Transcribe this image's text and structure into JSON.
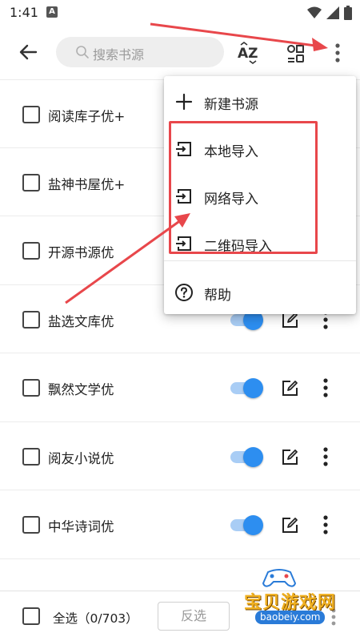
{
  "status_bar": {
    "time": "1:41",
    "notification_letter": "A"
  },
  "toolbar": {
    "search_placeholder": "搜索书源",
    "az_icon": "sort-az-icon",
    "group_icon": "group-icon",
    "more_icon": "more-vertical-icon"
  },
  "sources": [
    {
      "name": "阅读库子优+",
      "enabled": true
    },
    {
      "name": "盐神书屋优+",
      "enabled": true
    },
    {
      "name": "开源书源优",
      "enabled": true
    },
    {
      "name": "盐选文库优",
      "enabled": true
    },
    {
      "name": "飘然文学优",
      "enabled": true
    },
    {
      "name": "阅友小说优",
      "enabled": true
    },
    {
      "name": "中华诗词优",
      "enabled": true
    }
  ],
  "menu": {
    "new_source": "新建书源",
    "local_import": "本地导入",
    "network_import": "网络导入",
    "qr_import": "二维码导入",
    "help": "帮助"
  },
  "bottom_bar": {
    "select_all": "全选（0/703）",
    "invert": "反选"
  },
  "watermark": {
    "name": "宝贝游戏网",
    "url": "baobeiy.com"
  },
  "colors": {
    "accent": "#2d8ef0",
    "annotation": "#e8474b"
  }
}
